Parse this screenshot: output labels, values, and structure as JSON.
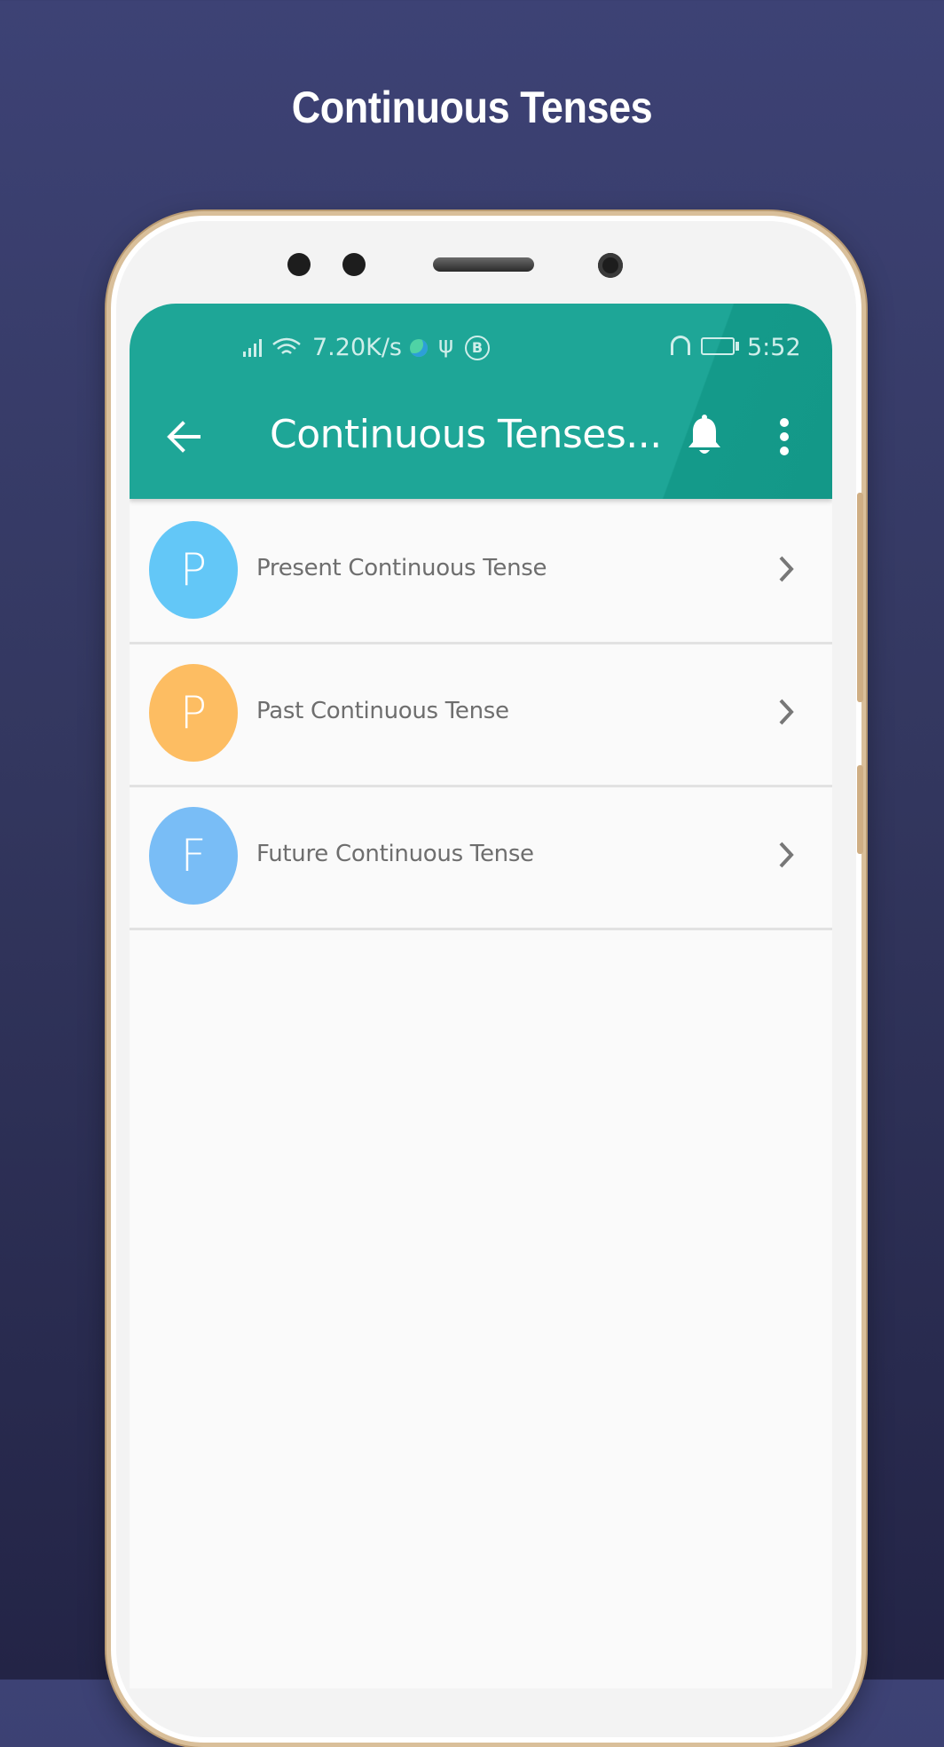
{
  "promo": {
    "title": "Continuous Tenses"
  },
  "status_bar": {
    "net_speed": "7.20K/s",
    "time": "5:52"
  },
  "toolbar": {
    "title": "Continuous Tenses...",
    "back_icon": "arrow-left-icon",
    "bell_icon": "bell-icon",
    "menu_icon": "more-vertical-icon"
  },
  "list": {
    "items": [
      {
        "letter": "P",
        "label": "Present Continuous Tense",
        "color": "#63c7f7"
      },
      {
        "letter": "P",
        "label": "Past Continuous Tense",
        "color": "#fdbd62"
      },
      {
        "letter": "F",
        "label": "Future Continuous Tense",
        "color": "#79bdf6"
      }
    ]
  },
  "colors": {
    "app_bar": "#1ea697",
    "background": "#3d4275",
    "phone_frame": "#d9bf9a"
  }
}
